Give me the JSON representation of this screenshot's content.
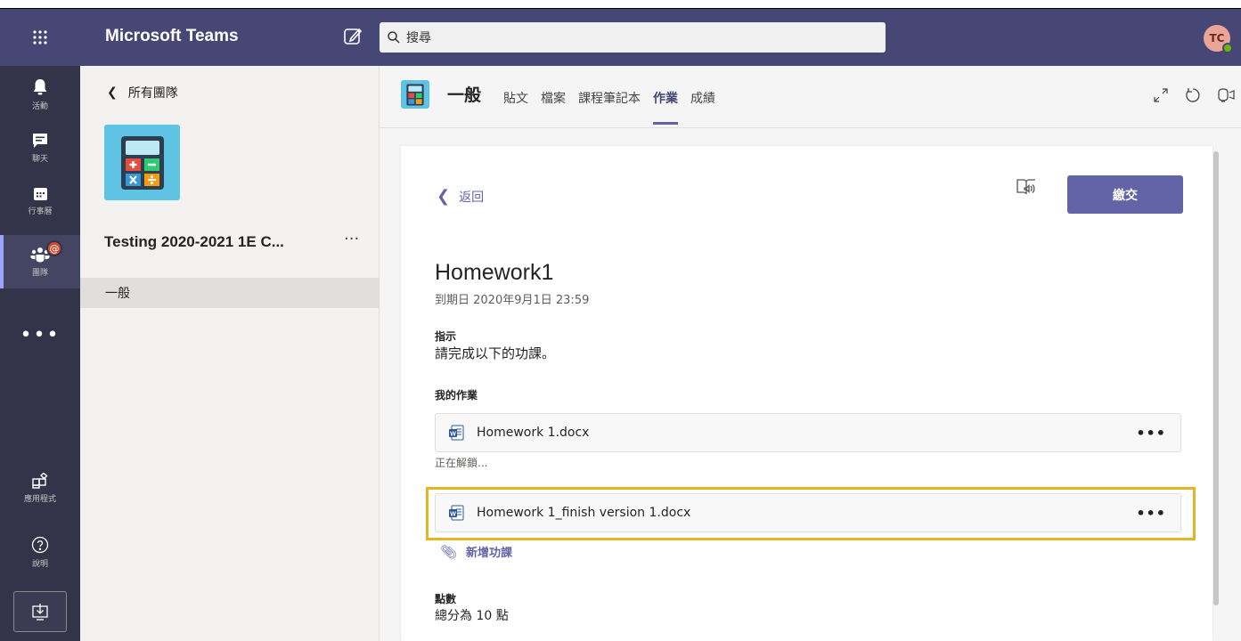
{
  "app": {
    "title": "Microsoft Teams",
    "search_placeholder": "搜尋",
    "avatar_initials": "TC"
  },
  "rail": {
    "items": [
      {
        "label": "活動",
        "icon": "bell-icon"
      },
      {
        "label": "聊天",
        "icon": "chat-icon"
      },
      {
        "label": "行事曆",
        "icon": "calendar-icon"
      },
      {
        "label": "團隊",
        "icon": "teams-icon",
        "badge": "@"
      },
      {
        "label": "應用程式",
        "icon": "apps-icon"
      },
      {
        "label": "說明",
        "icon": "help-icon"
      }
    ],
    "more": "•••"
  },
  "team_panel": {
    "back_label": "所有團隊",
    "team_name": "Testing 2020-2021 1E C...",
    "team_more": "···",
    "channel": "一般"
  },
  "channel_header": {
    "name": "一般",
    "tabs": [
      {
        "label": "貼文",
        "active": false
      },
      {
        "label": "檔案",
        "active": false
      },
      {
        "label": "課程筆記本",
        "active": false
      },
      {
        "label": "作業",
        "active": true
      },
      {
        "label": "成績",
        "active": false
      }
    ]
  },
  "assignment": {
    "back_label": "返回",
    "submit_label": "繳交",
    "title": "Homework1",
    "due": "到期日 2020年9月1日 23:59",
    "instructions_label": "指示",
    "instructions_text": "請完成以下的功課。",
    "my_work_label": "我的作業",
    "files": [
      {
        "name": "Homework 1.docx",
        "more": "•••"
      },
      {
        "name": "Homework 1_finish version 1.docx",
        "more": "•••"
      }
    ],
    "unlocking_text": "正在解鎖...",
    "add_work_label": "新增功課",
    "points_label": "點數",
    "points_text": "總分為 10 點"
  },
  "colors": {
    "topbar": "#464775",
    "rail": "#33344a",
    "accent": "#6264a7",
    "highlight": "#e4b522",
    "team_tile": "#5fc3e4"
  }
}
